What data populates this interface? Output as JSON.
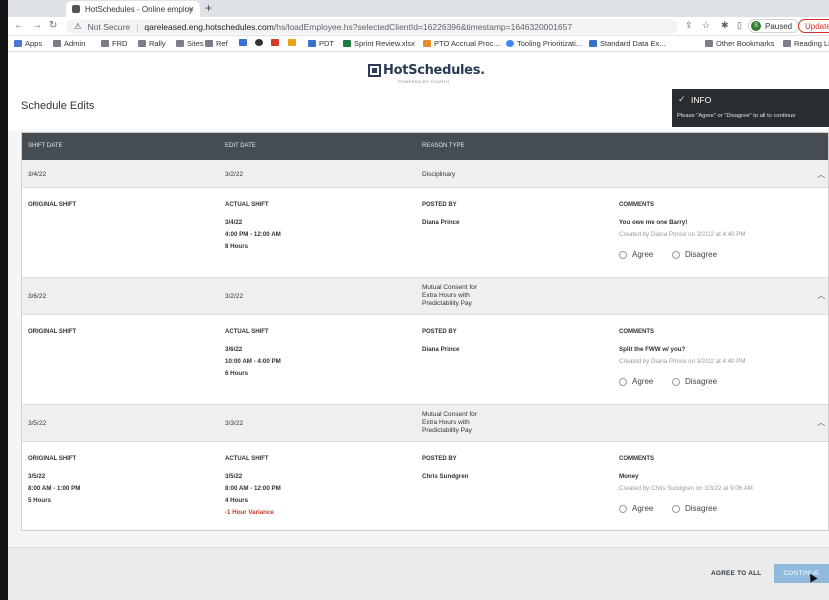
{
  "browser": {
    "tab_title": "HotSchedules - Online employ",
    "tab_close": "×",
    "new_tab": "+",
    "security": "Not Secure",
    "url_host": "qareleased.eng.hotschedules.com",
    "url_path": "/hs/loadEmployee.hs?selectedClientId=16226396&timestamp=1646320001657",
    "profile_initial": "S",
    "profile_status": "Paused",
    "update_label": "Update"
  },
  "bookmarks": [
    "Apps",
    "Admin",
    "FRD",
    "Rally",
    "Sites",
    "Ref",
    "PDT",
    "Sprint Review.xlsx",
    "PTO Accrual Proc...",
    "Tooling Prioritizati...",
    "Standard Data Ex...",
    "Other Bookmarks",
    "Reading Li"
  ],
  "app": {
    "logo_text": "HotSchedules.",
    "logo_sub": "POWERED BY FOURTH",
    "page_title": "Schedule Edits"
  },
  "toast": {
    "title": "INFO",
    "message": "Please \"Agree\" or \"Disagree\" to all to continue"
  },
  "table": {
    "headers": [
      "SHIFT DATE",
      "EDIT DATE",
      "REASON TYPE"
    ],
    "labels": {
      "original_shift": "ORIGINAL SHIFT",
      "actual_shift": "ACTUAL SHIFT",
      "posted_by": "POSTED BY",
      "comments": "COMMENTS",
      "agree": "Agree",
      "disagree": "Disagree"
    },
    "rows": [
      {
        "shift_date": "3/4/22",
        "edit_date": "3/2/22",
        "reason": [
          "Disciplinary"
        ],
        "original_lines": [],
        "actual_lines": [
          "3/4/22",
          "4:00 PM - 12:00 AM",
          "8 Hours"
        ],
        "posted_by": "Diana Prince",
        "comment": "You owe me one Barry!",
        "created": "Created by Diana Prince on 3/2/22 at 4:40 PM"
      },
      {
        "shift_date": "3/6/22",
        "edit_date": "3/2/22",
        "reason": [
          "Mutual Consent for",
          "Extra Hours with",
          "Predictability Pay"
        ],
        "original_lines": [],
        "actual_lines": [
          "3/6/22",
          "10:00 AM - 4:00 PM",
          "6 Hours"
        ],
        "posted_by": "Diana Prince",
        "comment": "Split the FWW w/ you?",
        "created": "Created by Diana Prince on 3/2/22 at 4:40 PM"
      },
      {
        "shift_date": "3/5/22",
        "edit_date": "3/3/22",
        "reason": [
          "Mutual Consent for",
          "Extra Hours with",
          "Predictability Pay"
        ],
        "original_lines": [
          "3/5/22",
          "8:00 AM - 1:00 PM",
          "5 Hours"
        ],
        "actual_lines": [
          "3/5/22",
          "8:00 AM - 12:00 PM",
          "4 Hours"
        ],
        "variance": "-1 Hour Variance",
        "posted_by": "Chris Sundgren",
        "comment": "Money",
        "created": "Created by Chris Sundgren on 3/3/22 at 9:06 AM"
      }
    ]
  },
  "footer": {
    "agree_all": "AGREE TO ALL",
    "continue": "CONTINUE"
  },
  "colors": {
    "table_header_bg": "#454d53",
    "toast_bg": "#2a2d30",
    "continue_bg": "#8fbadd",
    "variance_text": "#c0392b",
    "brand": "#2b3a55"
  },
  "icons": [
    "back-arrow-icon",
    "forward-arrow-icon",
    "reload-icon",
    "lock-warning-icon",
    "share-icon",
    "star-icon",
    "extensions-icon",
    "sidebar-icon",
    "check-icon",
    "chevron-up-icon",
    "folder-icon",
    "mouse-cursor-icon"
  ]
}
